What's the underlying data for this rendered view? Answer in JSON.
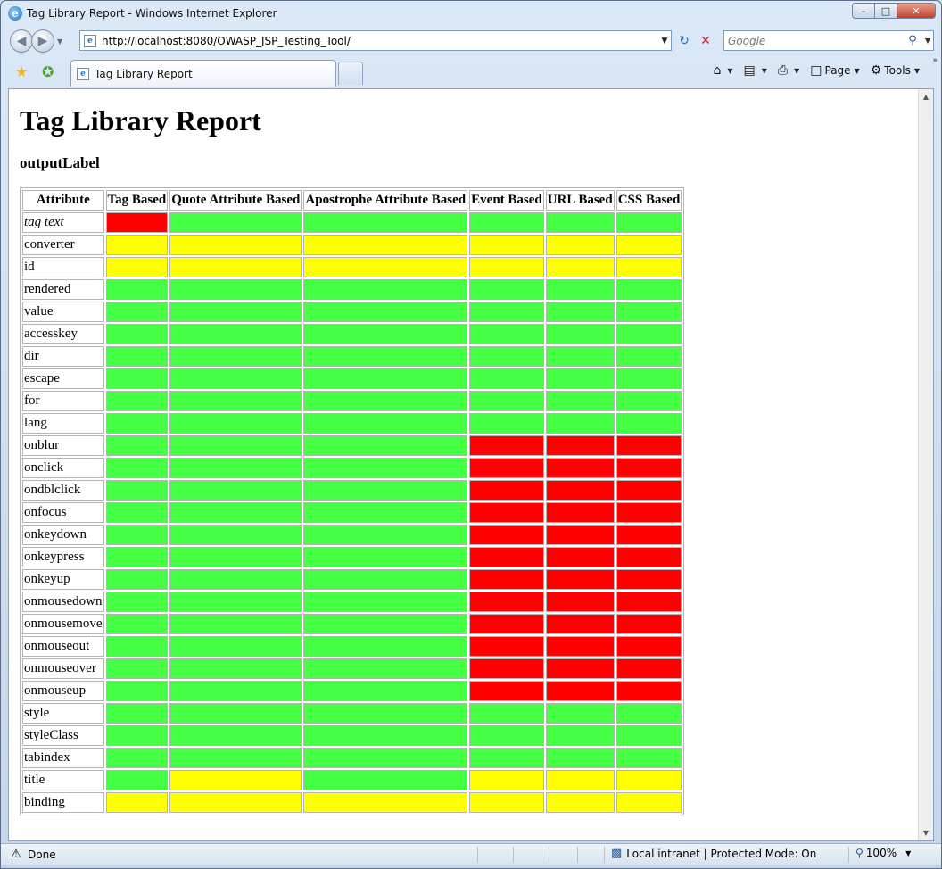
{
  "window": {
    "title": "Tag Library Report - Windows Internet Explorer",
    "controls": {
      "minimize": "–",
      "maximize": "□",
      "close": "✕"
    }
  },
  "address_bar": {
    "url": "http://localhost:8080/OWASP_JSP_Testing_Tool/",
    "search_placeholder": "Google"
  },
  "tab": {
    "label": "Tag Library Report"
  },
  "command_bar": {
    "page_label": "Page",
    "tools_label": "Tools"
  },
  "page": {
    "title": "Tag Library Report",
    "subtitle": "outputLabel"
  },
  "colors": {
    "green": "#44ff44",
    "yellow": "#ffff00",
    "red": "#ff0000"
  },
  "table": {
    "headers": [
      "Attribute",
      "Tag Based",
      "Quote Attribute Based",
      "Apostrophe Attribute Based",
      "Event Based",
      "URL Based",
      "CSS Based"
    ],
    "rows": [
      {
        "name": "tag text",
        "italic": true,
        "cells": [
          "red",
          "green",
          "green",
          "green",
          "green",
          "green"
        ]
      },
      {
        "name": "converter",
        "cells": [
          "yellow",
          "yellow",
          "yellow",
          "yellow",
          "yellow",
          "yellow"
        ]
      },
      {
        "name": "id",
        "cells": [
          "yellow",
          "yellow",
          "yellow",
          "yellow",
          "yellow",
          "yellow"
        ]
      },
      {
        "name": "rendered",
        "cells": [
          "green",
          "green",
          "green",
          "green",
          "green",
          "green"
        ]
      },
      {
        "name": "value",
        "cells": [
          "green",
          "green",
          "green",
          "green",
          "green",
          "green"
        ]
      },
      {
        "name": "accesskey",
        "cells": [
          "green",
          "green",
          "green",
          "green",
          "green",
          "green"
        ]
      },
      {
        "name": "dir",
        "cells": [
          "green",
          "green",
          "green",
          "green",
          "green",
          "green"
        ]
      },
      {
        "name": "escape",
        "cells": [
          "green",
          "green",
          "green",
          "green",
          "green",
          "green"
        ]
      },
      {
        "name": "for",
        "cells": [
          "green",
          "green",
          "green",
          "green",
          "green",
          "green"
        ]
      },
      {
        "name": "lang",
        "cells": [
          "green",
          "green",
          "green",
          "green",
          "green",
          "green"
        ]
      },
      {
        "name": "onblur",
        "cells": [
          "green",
          "green",
          "green",
          "red",
          "red",
          "red"
        ]
      },
      {
        "name": "onclick",
        "cells": [
          "green",
          "green",
          "green",
          "red",
          "red",
          "red"
        ]
      },
      {
        "name": "ondblclick",
        "cells": [
          "green",
          "green",
          "green",
          "red",
          "red",
          "red"
        ]
      },
      {
        "name": "onfocus",
        "cells": [
          "green",
          "green",
          "green",
          "red",
          "red",
          "red"
        ]
      },
      {
        "name": "onkeydown",
        "cells": [
          "green",
          "green",
          "green",
          "red",
          "red",
          "red"
        ]
      },
      {
        "name": "onkeypress",
        "cells": [
          "green",
          "green",
          "green",
          "red",
          "red",
          "red"
        ]
      },
      {
        "name": "onkeyup",
        "cells": [
          "green",
          "green",
          "green",
          "red",
          "red",
          "red"
        ]
      },
      {
        "name": "onmousedown",
        "cells": [
          "green",
          "green",
          "green",
          "red",
          "red",
          "red"
        ]
      },
      {
        "name": "onmousemove",
        "cells": [
          "green",
          "green",
          "green",
          "red",
          "red",
          "red"
        ]
      },
      {
        "name": "onmouseout",
        "cells": [
          "green",
          "green",
          "green",
          "red",
          "red",
          "red"
        ]
      },
      {
        "name": "onmouseover",
        "cells": [
          "green",
          "green",
          "green",
          "red",
          "red",
          "red"
        ]
      },
      {
        "name": "onmouseup",
        "cells": [
          "green",
          "green",
          "green",
          "red",
          "red",
          "red"
        ]
      },
      {
        "name": "style",
        "cells": [
          "green",
          "green",
          "green",
          "green",
          "green",
          "green"
        ]
      },
      {
        "name": "styleClass",
        "cells": [
          "green",
          "green",
          "green",
          "green",
          "green",
          "green"
        ]
      },
      {
        "name": "tabindex",
        "cells": [
          "green",
          "green",
          "green",
          "green",
          "green",
          "green"
        ]
      },
      {
        "name": "title",
        "cells": [
          "green",
          "yellow",
          "green",
          "yellow",
          "yellow",
          "yellow"
        ]
      },
      {
        "name": "binding",
        "cells": [
          "yellow",
          "yellow",
          "yellow",
          "yellow",
          "yellow",
          "yellow"
        ]
      }
    ]
  },
  "status_bar": {
    "status": "Done",
    "zone": "Local intranet | Protected Mode: On",
    "zoom": "100%"
  }
}
